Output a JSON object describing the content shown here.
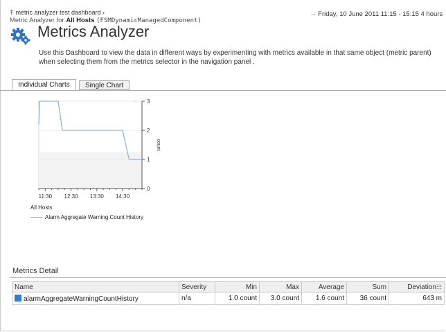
{
  "header": {
    "breadcrumb_icon": "Ŧ",
    "breadcrumb": "metric analyzer test dashboard ›",
    "subtitle_prefix": "Metric Analyzer for",
    "subtitle_host": "All Hosts",
    "subtitle_component": "(FSMDynamicManagedComponent)",
    "timerange": "Friday, 10 June 2011 11:15 - 15:15 4 hours",
    "timerange_icon": "→",
    "page_title": "Metrics Analyzer"
  },
  "description": "Use this Dashboard to view the data in different ways by experimenting with metrics available in that same object (metric parent) when selecting them from the metrics selector in the navigation panel .",
  "tabs": [
    "Individual Charts",
    "Single Chart"
  ],
  "chart_data": {
    "type": "line",
    "x_ticks": [
      "11:30",
      "12:30",
      "13:30",
      "14:30"
    ],
    "y_ticks": [
      "0",
      "1",
      "2",
      "3"
    ],
    "ylabel": "count",
    "ylim": [
      0,
      3
    ],
    "series": [
      {
        "name": "Alarm Aggregate Warning Count History",
        "x": [
          "11:15",
          "11:17",
          "12:00",
          "12:10",
          "14:30",
          "14:45",
          "15:15"
        ],
        "y": [
          2.2,
          3.0,
          3.0,
          2.0,
          2.0,
          1.0,
          1.0
        ]
      }
    ],
    "caption": "All Hosts",
    "color": "#8fb3db"
  },
  "metrics_detail": {
    "title": "Metrics Detail",
    "columns": [
      "Name",
      "Severity",
      "Min",
      "Max",
      "Average",
      "Sum",
      "Deviation"
    ],
    "rows": [
      [
        "alarmAggregateWarningCountHistory",
        "n/a",
        "1.0 count",
        "3.0 count",
        "1.6 count",
        "36 count",
        "643 m"
      ]
    ]
  }
}
